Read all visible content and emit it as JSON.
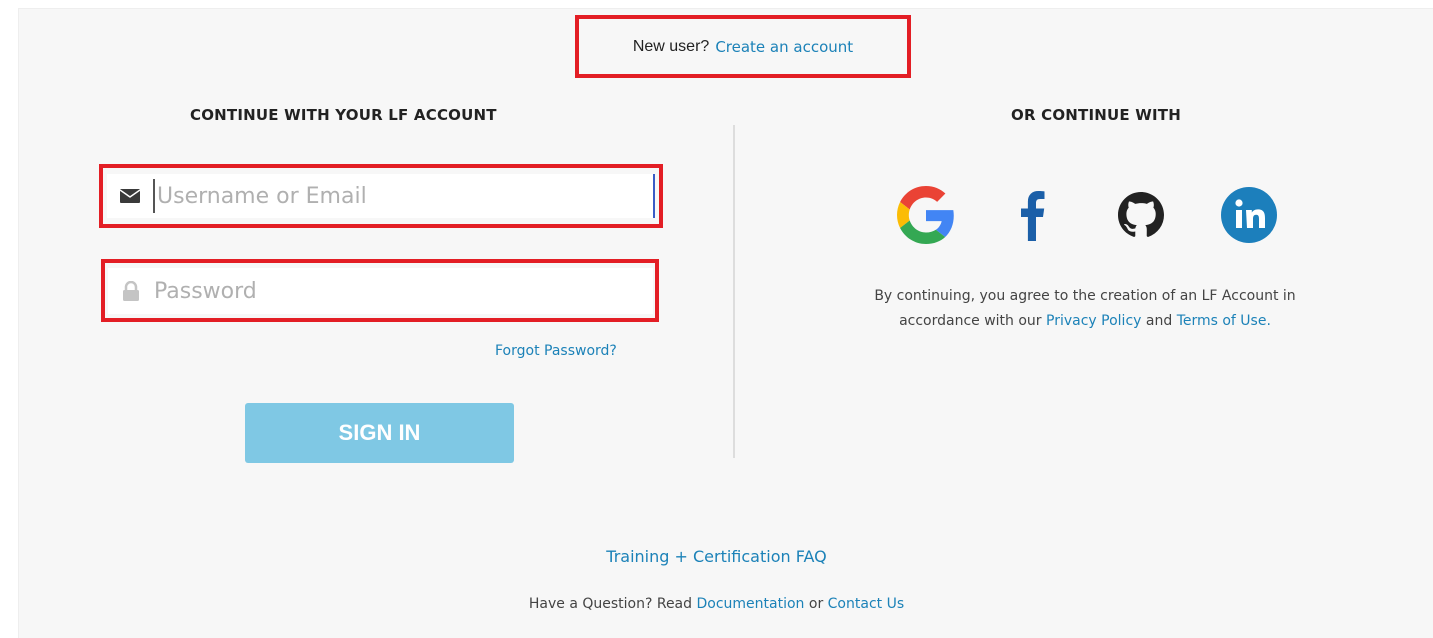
{
  "header": {
    "new_user_text": "New user?",
    "create_account_link": "Create an account"
  },
  "left": {
    "heading": "CONTINUE WITH YOUR LF ACCOUNT",
    "username_placeholder": "Username or Email",
    "username_value": "",
    "password_placeholder": "Password",
    "password_value": "",
    "forgot_password": "Forgot Password?",
    "sign_in": "SIGN IN"
  },
  "right": {
    "heading": "OR CONTINUE WITH",
    "social_providers": [
      {
        "name": "Google",
        "icon": "google-icon"
      },
      {
        "name": "Facebook",
        "icon": "facebook-icon"
      },
      {
        "name": "GitHub",
        "icon": "github-icon"
      },
      {
        "name": "LinkedIn",
        "icon": "linkedin-icon"
      }
    ],
    "consent_part1": "By continuing, you agree to the creation of an LF Account in",
    "consent_part2": "accordance with our",
    "privacy_policy": "Privacy Policy",
    "consent_and": "and",
    "terms_of_use": "Terms of Use."
  },
  "footer": {
    "faq_link": "Training + Certification FAQ",
    "question_text": "Have a Question? Read",
    "documentation_link": "Documentation",
    "or_text": "or",
    "contact_link": "Contact Us"
  },
  "colors": {
    "link": "#1c82b8",
    "sign_in_button": "#7fc8e4",
    "highlight_border": "#e31e25",
    "panel_background": "#f7f7f7"
  }
}
